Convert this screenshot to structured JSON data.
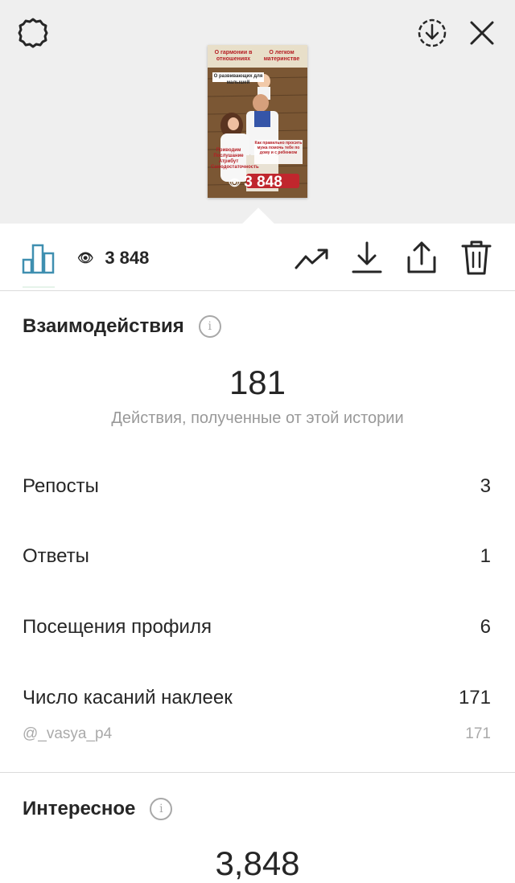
{
  "header": {
    "settings_icon": "gear-icon",
    "download_circle_icon": "download-circle-icon",
    "close_icon": "close-icon"
  },
  "thumbnail": {
    "text_top_left": "О гармонии в отношениях",
    "text_top_right": "О легком материнстве",
    "text_middle": "О развивающих для малышей",
    "text_right": "Как правильно просить мужа помочь тебе по дому и с ребенком",
    "text_left": "Приводим Послушание Атрибут Самодостаточность",
    "views_overlay": "3 848"
  },
  "toolbar": {
    "views_count": "3 848",
    "icons": [
      "bar-chart-icon",
      "eye-icon",
      "trend-icon",
      "download-icon",
      "share-icon",
      "trash-icon"
    ]
  },
  "interactions": {
    "title": "Взаимодействия",
    "total": "181",
    "description": "Действия, полученные от этой истории",
    "rows": [
      {
        "label": "Репосты",
        "value": "3"
      },
      {
        "label": "Ответы",
        "value": "1"
      },
      {
        "label": "Посещения профиля",
        "value": "6"
      },
      {
        "label": "Число касаний наклеек",
        "value": "171"
      }
    ],
    "sticker_sub": {
      "label": "@_vasya_p4",
      "value": "171"
    }
  },
  "discovery": {
    "title": "Интересное",
    "total": "3,848"
  },
  "colors": {
    "accent": "#3f8fb0",
    "background_top": "#efefef",
    "muted": "#999999"
  }
}
